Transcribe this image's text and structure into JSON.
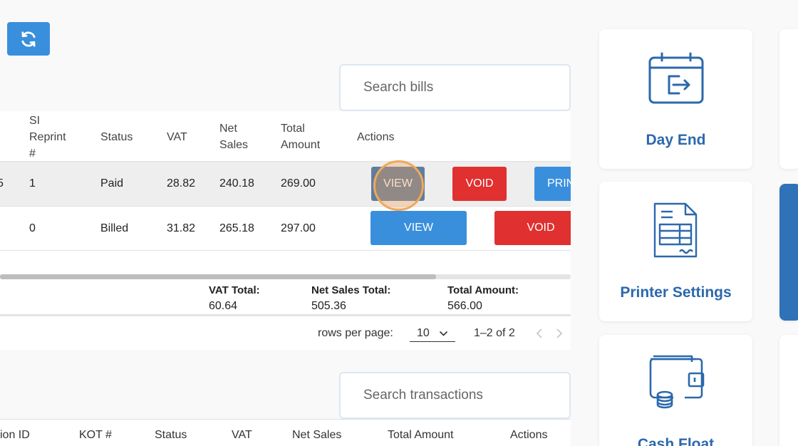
{
  "toolbar": {
    "refresh_icon": "refresh-icon"
  },
  "bills": {
    "search_placeholder": "Search bills",
    "headers": {
      "si_reprint_1": "SI",
      "si_reprint_2": "Reprint",
      "si_reprint_3": "#",
      "status": "Status",
      "vat": "VAT",
      "net_sales_1": "Net",
      "net_sales_2": "Sales",
      "total_amount_1": "Total",
      "total_amount_2": "Amount",
      "actions": "Actions"
    },
    "rows": [
      {
        "cut_prefix": "5",
        "si_reprint": "1",
        "status": "Paid",
        "vat": "28.82",
        "net_sales": "240.18",
        "total": "269.00",
        "view": "VIEW",
        "void": "VOID",
        "print": "PRIN"
      },
      {
        "si_reprint": "0",
        "status": "Billed",
        "vat": "31.82",
        "net_sales": "265.18",
        "total": "297.00",
        "view": "VIEW",
        "void": "VOID"
      }
    ],
    "totals": {
      "vat_label": "VAT Total:",
      "vat_value": "60.64",
      "net_label": "Net Sales Total:",
      "net_value": "505.36",
      "total_label": "Total Amount:",
      "total_value": "566.00"
    },
    "pagination": {
      "rows_per_page_label": "rows per page:",
      "rows_per_page_value": "10",
      "range": "1–2 of 2"
    }
  },
  "transactions": {
    "search_placeholder": "Search transactions",
    "headers": {
      "tx_id": "ion ID",
      "kot": "KOT #",
      "status": "Status",
      "vat": "VAT",
      "net_sales": "Net Sales",
      "total_amount": "Total Amount",
      "actions": "Actions"
    }
  },
  "cards": {
    "day_end": {
      "label": "Day End",
      "icon": "calendar-exit-icon"
    },
    "printer_settings": {
      "label": "Printer Settings",
      "icon": "receipt-icon"
    },
    "cash_float": {
      "label": "Cash Float",
      "icon": "wallet-coins-icon"
    }
  },
  "colors": {
    "primary": "#3a8fdc",
    "danger": "#e03030",
    "card_text": "#2c68ad"
  }
}
